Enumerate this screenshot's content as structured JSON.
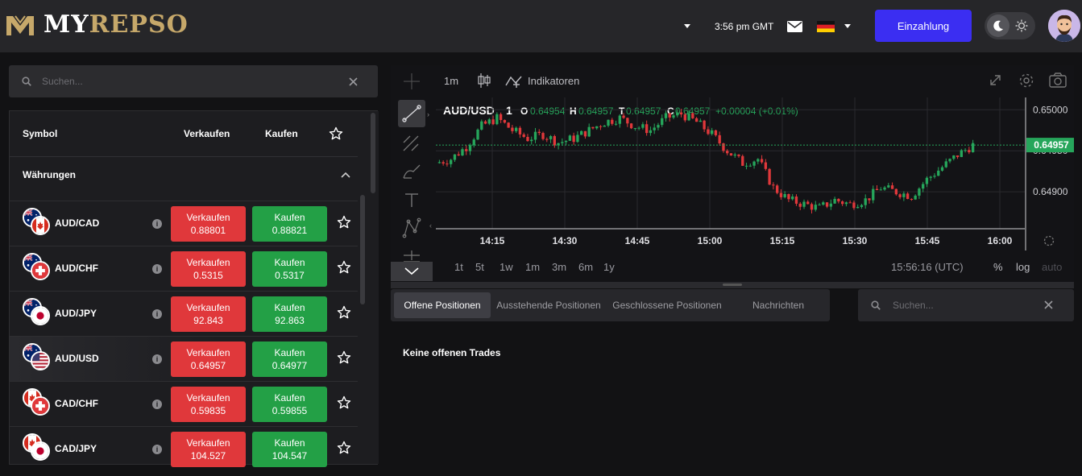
{
  "header": {
    "logo_my": "MY",
    "logo_repso": "REPSO",
    "time": "3:56 pm GMT",
    "deposit_label": "Einzahlung"
  },
  "search": {
    "placeholder": "Suchen..."
  },
  "table": {
    "col_symbol": "Symbol",
    "col_sell": "Verkaufen",
    "col_buy": "Kaufen",
    "section": "Währungen",
    "rows": [
      {
        "symbol": "AUD/CAD",
        "sell_label": "Verkaufen",
        "sell": "0.88801",
        "buy_label": "Kaufen",
        "buy": "0.88821"
      },
      {
        "symbol": "AUD/CHF",
        "sell_label": "Verkaufen",
        "sell": "0.5315",
        "buy_label": "Kaufen",
        "buy": "0.5317"
      },
      {
        "symbol": "AUD/JPY",
        "sell_label": "Verkaufen",
        "sell": "92.843",
        "buy_label": "Kaufen",
        "buy": "92.863"
      },
      {
        "symbol": "AUD/USD",
        "sell_label": "Verkaufen",
        "sell": "0.64957",
        "buy_label": "Kaufen",
        "buy": "0.64977"
      },
      {
        "symbol": "CAD/CHF",
        "sell_label": "Verkaufen",
        "sell": "0.59835",
        "buy_label": "Kaufen",
        "buy": "0.59855"
      },
      {
        "symbol": "CAD/JPY",
        "sell_label": "Verkaufen",
        "sell": "104.527",
        "buy_label": "Kaufen",
        "buy": "104.547"
      }
    ],
    "info_glyph": "i"
  },
  "chart": {
    "interval": "1m",
    "indicators_label": "Indikatoren",
    "symbol": "AUD/USD",
    "symbol_interval": "1",
    "o_label": "O",
    "o": "0.64954",
    "h_label": "H",
    "h": "0.64957",
    "t_label": "T",
    "t": "0.64957",
    "c_label": "C",
    "c": "0.64957",
    "change": "+0.00004 (+0.01%)",
    "price_levels": [
      "0.65000",
      "0.64950",
      "0.64900"
    ],
    "current_price": "0.64957",
    "time_labels": [
      "14:15",
      "14:30",
      "14:45",
      "15:00",
      "15:15",
      "15:30",
      "15:45",
      "16:00"
    ],
    "ranges": [
      "1t",
      "5t",
      "1w",
      "1m",
      "3m",
      "6m",
      "1y"
    ],
    "clock": "15:56:16 (UTC)",
    "scale_pct": "%",
    "scale_log": "log",
    "scale_auto": "auto",
    "up_color": "#26a65b",
    "down_color": "#e0383b"
  },
  "chart_data": {
    "type": "candlestick",
    "symbol": "AUD/USD",
    "x_ticks": [
      "14:15",
      "14:30",
      "14:45",
      "15:00",
      "15:15",
      "15:30",
      "15:45",
      "16:00"
    ],
    "y_ticks": [
      0.65,
      0.6495,
      0.649
    ],
    "ylim": [
      0.64855,
      0.65015
    ],
    "close_path": [
      0.64935,
      0.6494,
      0.64955,
      0.6498,
      0.6499,
      0.64975,
      0.64965,
      0.6497,
      0.6496,
      0.64965,
      0.64975,
      0.64985,
      0.6499,
      0.6498,
      0.64975,
      0.6499,
      0.64995,
      0.64985,
      0.6497,
      0.6495,
      0.64935,
      0.6494,
      0.64905,
      0.6489,
      0.64885,
      0.6488,
      0.6489,
      0.64885,
      0.6489,
      0.64905,
      0.649,
      0.64895,
      0.64915,
      0.6493,
      0.64945,
      0.64957
    ],
    "last": 0.64957
  },
  "tabs": {
    "open": "Offene Positionen",
    "pending": "Ausstehende Positionen",
    "closed": "Geschlossene Positionen",
    "news": "Nachrichten"
  },
  "positions": {
    "empty": "Keine offenen Trades"
  }
}
